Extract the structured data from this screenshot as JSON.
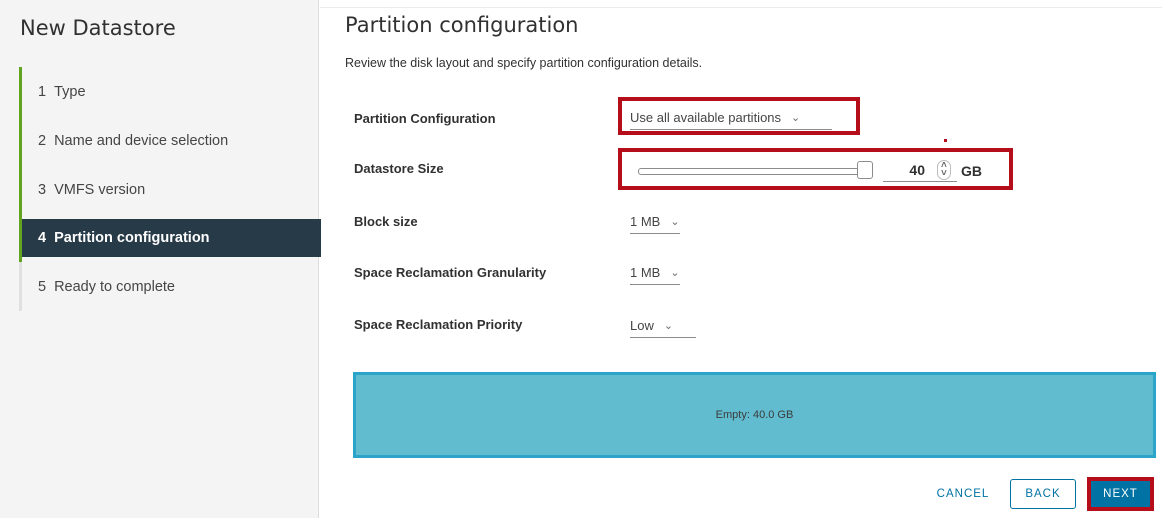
{
  "sidebar": {
    "title": "New Datastore",
    "steps": [
      {
        "num": "1",
        "label": "Type"
      },
      {
        "num": "2",
        "label": "Name and device selection"
      },
      {
        "num": "3",
        "label": "VMFS version"
      },
      {
        "num": "4",
        "label": "Partition configuration"
      },
      {
        "num": "5",
        "label": "Ready to complete"
      }
    ],
    "active_step": 4
  },
  "main": {
    "title": "Partition configuration",
    "subtitle": "Review the disk layout and specify partition configuration details.",
    "fields": {
      "partition_config": {
        "label": "Partition Configuration",
        "value": "Use all available partitions"
      },
      "datastore_size": {
        "label": "Datastore Size",
        "value": "40",
        "unit": "GB",
        "slider_fraction": 1.0
      },
      "block_size": {
        "label": "Block size",
        "value": "1 MB"
      },
      "reclaim_granularity": {
        "label": "Space Reclamation Granularity",
        "value": "1 MB"
      },
      "reclaim_priority": {
        "label": "Space Reclamation Priority",
        "value": "Low"
      }
    },
    "disk_layout": {
      "label": "Empty: 40.0 GB"
    }
  },
  "footer": {
    "cancel": "CANCEL",
    "back": "BACK",
    "next": "NEXT"
  },
  "colors": {
    "accent": "#0072a3",
    "highlight": "#b50d1a",
    "progress": "#62a420",
    "active_step_bg": "#273a48",
    "disk_bar": "#61bcd0"
  }
}
